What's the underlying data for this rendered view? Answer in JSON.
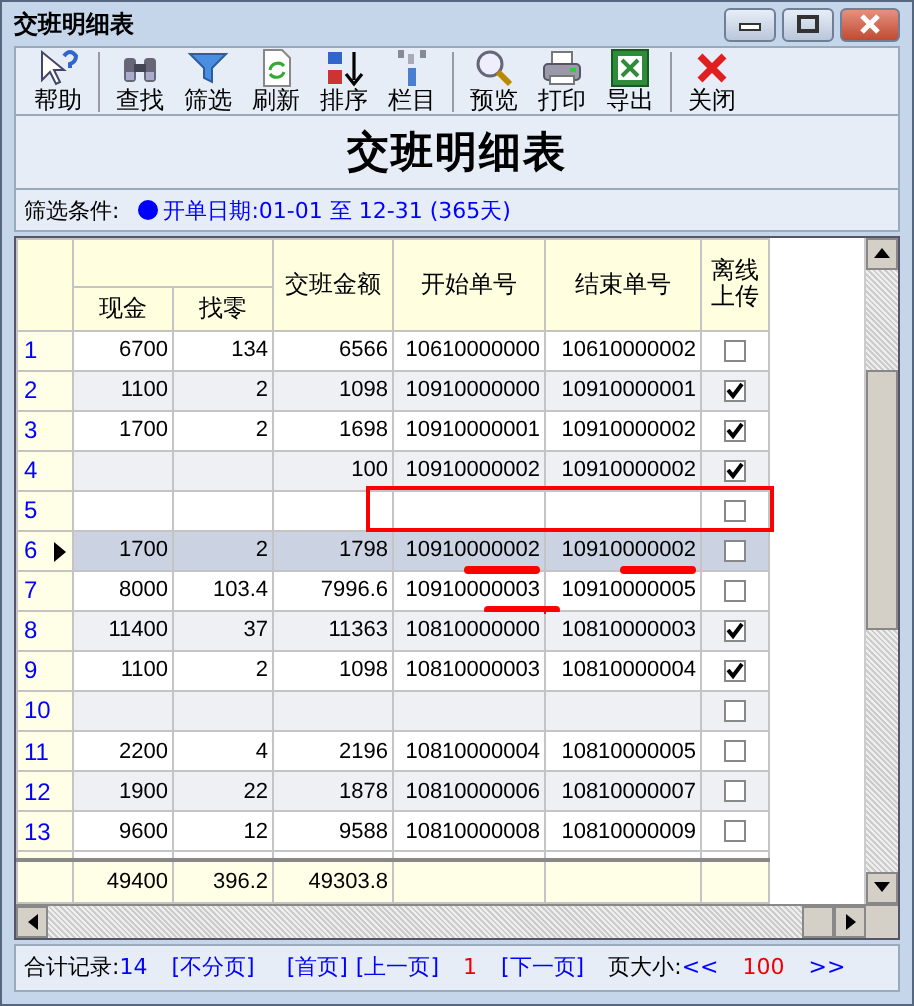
{
  "window": {
    "title": "交班明细表"
  },
  "toolbar": [
    [
      {
        "label": "帮助"
      }
    ],
    [
      {
        "label": "查找"
      },
      {
        "label": "筛选"
      },
      {
        "label": "刷新"
      },
      {
        "label": "排序"
      },
      {
        "label": "栏目"
      }
    ],
    [
      {
        "label": "预览"
      },
      {
        "label": "打印"
      },
      {
        "label": "导出"
      }
    ],
    [
      {
        "label": "关闭"
      }
    ]
  ],
  "heading": "交班明细表",
  "filter": {
    "label": "筛选条件:",
    "condition": "开单日期:01-01 至 12-31 (365天)"
  },
  "table": {
    "columns": [
      "现金",
      "找零",
      "交班金额",
      "开始单号",
      "结束单号",
      "离线上传"
    ],
    "rows": [
      {
        "no": "1",
        "cash": "6700",
        "change": "134",
        "amount": "6566",
        "start": "10610000000",
        "end": "10610000002",
        "uploaded": false,
        "selected": false,
        "boxed": false,
        "start_underlined": false,
        "end_underlined": false
      },
      {
        "no": "2",
        "cash": "1100",
        "change": "2",
        "amount": "1098",
        "start": "10910000000",
        "end": "10910000001",
        "uploaded": true,
        "selected": false,
        "boxed": false,
        "start_underlined": false,
        "end_underlined": false
      },
      {
        "no": "3",
        "cash": "1700",
        "change": "2",
        "amount": "1698",
        "start": "10910000001",
        "end": "10910000002",
        "uploaded": true,
        "selected": false,
        "boxed": false,
        "start_underlined": false,
        "end_underlined": false
      },
      {
        "no": "4",
        "amount": "100",
        "start": "10910000002",
        "end": "10910000002",
        "uploaded": true,
        "selected": false,
        "boxed": false,
        "start_underlined": false,
        "end_underlined": false
      },
      {
        "no": "5",
        "uploaded": false,
        "selected": false,
        "boxed": true,
        "start_underlined": false,
        "end_underlined": false
      },
      {
        "no": "6",
        "cash": "1700",
        "change": "2",
        "amount": "1798",
        "start": "10910000002",
        "end": "10910000002",
        "uploaded": false,
        "selected": true,
        "boxed": false,
        "start_underlined": true,
        "end_underlined": true
      },
      {
        "no": "7",
        "cash": "8000",
        "change": "103.4",
        "amount": "7996.6",
        "start": "10910000003",
        "end": "10910000005",
        "uploaded": false,
        "selected": false,
        "boxed": false,
        "start_underlined": true,
        "end_underlined": false
      },
      {
        "no": "8",
        "cash": "11400",
        "change": "37",
        "amount": "11363",
        "start": "10810000000",
        "end": "10810000003",
        "uploaded": true,
        "selected": false,
        "boxed": false,
        "start_underlined": false,
        "end_underlined": false
      },
      {
        "no": "9",
        "cash": "1100",
        "change": "2",
        "amount": "1098",
        "start": "10810000003",
        "end": "10810000004",
        "uploaded": true,
        "selected": false,
        "boxed": false,
        "start_underlined": false,
        "end_underlined": false
      },
      {
        "no": "10",
        "uploaded": false,
        "selected": false,
        "boxed": false,
        "start_underlined": false,
        "end_underlined": false
      },
      {
        "no": "11",
        "cash": "2200",
        "change": "4",
        "amount": "2196",
        "start": "10810000004",
        "end": "10810000005",
        "uploaded": false,
        "selected": false,
        "boxed": false,
        "start_underlined": false,
        "end_underlined": false
      },
      {
        "no": "12",
        "cash": "1900",
        "change": "22",
        "amount": "1878",
        "start": "10810000006",
        "end": "10810000007",
        "uploaded": false,
        "selected": false,
        "boxed": false,
        "start_underlined": false,
        "end_underlined": false
      },
      {
        "no": "13",
        "cash": "9600",
        "change": "12",
        "amount": "9588",
        "start": "10810000008",
        "end": "10810000009",
        "uploaded": false,
        "selected": false,
        "boxed": false,
        "start_underlined": false,
        "end_underlined": false
      }
    ],
    "totals": {
      "cash": "49400",
      "change": "396.2",
      "amount": "49303.8"
    }
  },
  "status_bar": {
    "label": "合计记录:",
    "count": "14",
    "links": [
      "[不分页]",
      "[首页]",
      "[上一页]"
    ],
    "page": "1",
    "next": "[下一页]",
    "size_label": "页大小:",
    "prev_size": "<<",
    "size": "100",
    "next_size": ">>"
  }
}
